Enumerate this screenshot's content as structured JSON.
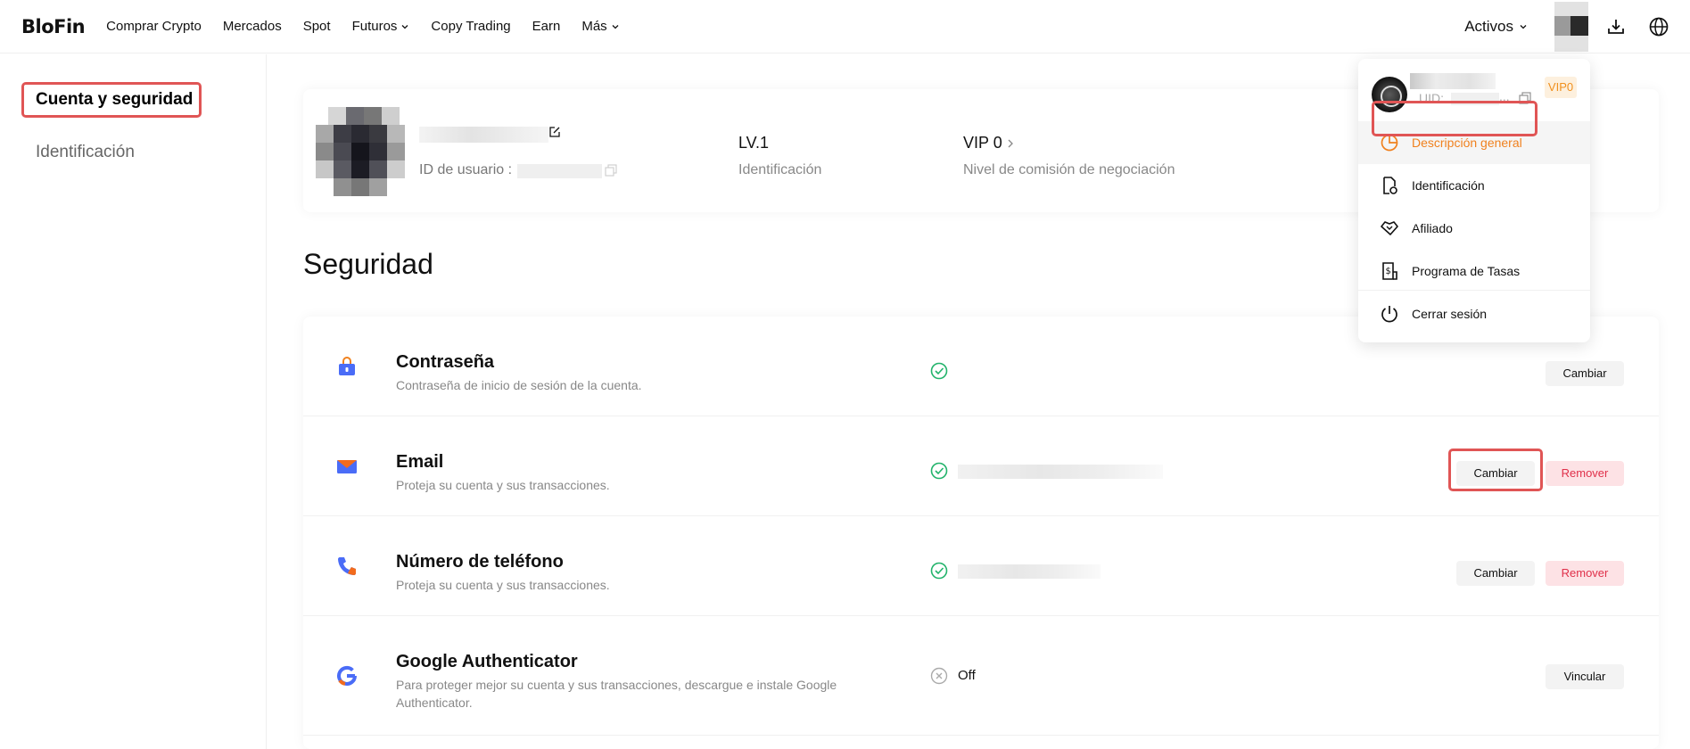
{
  "brand": {
    "logo": "BloFin"
  },
  "nav": {
    "items": [
      {
        "label": "Comprar Crypto",
        "dropdown": false
      },
      {
        "label": "Mercados",
        "dropdown": false
      },
      {
        "label": "Spot",
        "dropdown": false
      },
      {
        "label": "Futuros",
        "dropdown": true
      },
      {
        "label": "Copy Trading",
        "dropdown": false
      },
      {
        "label": "Earn",
        "dropdown": false
      },
      {
        "label": "Más",
        "dropdown": true
      }
    ],
    "activos": "Activos"
  },
  "sidebar": {
    "items": [
      {
        "label": "Cuenta y seguridad",
        "active": true
      },
      {
        "label": "Identificación",
        "active": false
      }
    ]
  },
  "profile": {
    "uid_label": "ID de usuario :",
    "level_value": "LV.1",
    "level_label": "Identificación",
    "vip_value": "VIP 0",
    "vip_label": "Nivel de comisión de negociación"
  },
  "security": {
    "title": "Seguridad",
    "rows": [
      {
        "name": "Contraseña",
        "desc": "Contraseña de inicio de sesión de la cuenta.",
        "status": "enabled",
        "status_text": "",
        "buttons": [
          "Cambiar"
        ]
      },
      {
        "name": "Email",
        "desc": "Proteja su cuenta y sus transacciones.",
        "status": "enabled",
        "status_text": "",
        "buttons": [
          "Cambiar",
          "Remover"
        ]
      },
      {
        "name": "Número de teléfono",
        "desc": "Proteja su cuenta y sus transacciones.",
        "status": "enabled",
        "status_text": "",
        "buttons": [
          "Cambiar",
          "Remover"
        ]
      },
      {
        "name": "Google Authenticator",
        "desc": "Para proteger mejor su cuenta y sus transacciones, descargue e instale Google Authenticator.",
        "status": "disabled",
        "status_text": "Off",
        "buttons": [
          "Vincular"
        ]
      }
    ]
  },
  "account_menu": {
    "uid_label": "UID:",
    "uid_dots": "...",
    "vip_badge": "VIP0",
    "items": [
      {
        "label": "Descripción general",
        "icon": "pie-chart-icon",
        "active": true
      },
      {
        "label": "Identificación",
        "icon": "document-badge-icon",
        "active": false
      },
      {
        "label": "Afiliado",
        "icon": "handshake-icon",
        "active": false
      },
      {
        "label": "Programa de Tasas",
        "icon": "receipt-icon",
        "active": false
      },
      {
        "label": "Cerrar sesión",
        "icon": "power-icon",
        "active": false
      }
    ]
  },
  "colors": {
    "accent_orange": "#f0811e",
    "success_green": "#22b36b",
    "danger_red": "#e0304a",
    "highlight_red": "#e05555"
  }
}
